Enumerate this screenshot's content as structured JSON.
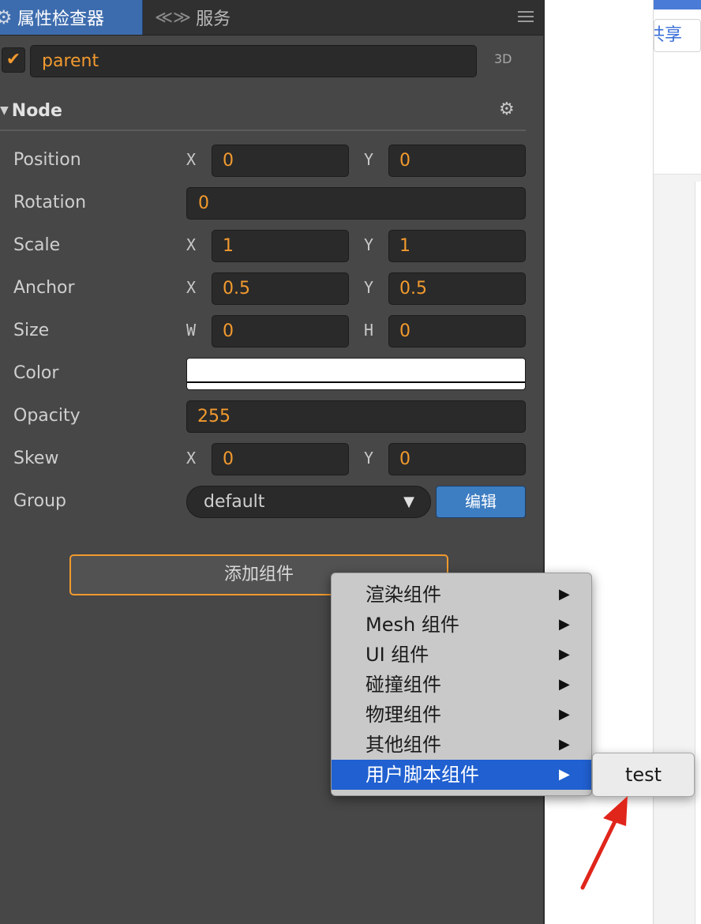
{
  "tabs": {
    "inspector_label": "属性检查器",
    "services_label": "服务"
  },
  "right_pane": {
    "share_label": "共享"
  },
  "node_name": {
    "value": "parent",
    "mode_label": "3D",
    "enabled": true
  },
  "node_section": {
    "title": "Node"
  },
  "properties": {
    "position": {
      "label": "Position",
      "x_axis": "X",
      "x": "0",
      "y_axis": "Y",
      "y": "0"
    },
    "rotation": {
      "label": "Rotation",
      "value": "0"
    },
    "scale": {
      "label": "Scale",
      "x_axis": "X",
      "x": "1",
      "y_axis": "Y",
      "y": "1"
    },
    "anchor": {
      "label": "Anchor",
      "x_axis": "X",
      "x": "0.5",
      "y_axis": "Y",
      "y": "0.5"
    },
    "size": {
      "label": "Size",
      "w_axis": "W",
      "w": "0",
      "h_axis": "H",
      "h": "0"
    },
    "color": {
      "label": "Color",
      "value": "#ffffff"
    },
    "opacity": {
      "label": "Opacity",
      "value": "255"
    },
    "skew": {
      "label": "Skew",
      "x_axis": "X",
      "x": "0",
      "y_axis": "Y",
      "y": "0"
    },
    "group": {
      "label": "Group",
      "selected": "default",
      "edit_label": "编辑"
    }
  },
  "add_component": {
    "label": "添加组件"
  },
  "context_menu": {
    "items": [
      {
        "label": "渲染组件"
      },
      {
        "label": "Mesh 组件"
      },
      {
        "label": "UI 组件"
      },
      {
        "label": "碰撞组件"
      },
      {
        "label": "物理组件"
      },
      {
        "label": "其他组件"
      },
      {
        "label": "用户脚本组件",
        "selected": true
      }
    ],
    "submenu_items": [
      {
        "label": "test"
      }
    ]
  },
  "colors": {
    "accent_orange": "#f29a2e",
    "tab_active": "#3d6cae",
    "menu_selected": "#2060d0",
    "annotation_arrow": "#e0251b"
  }
}
